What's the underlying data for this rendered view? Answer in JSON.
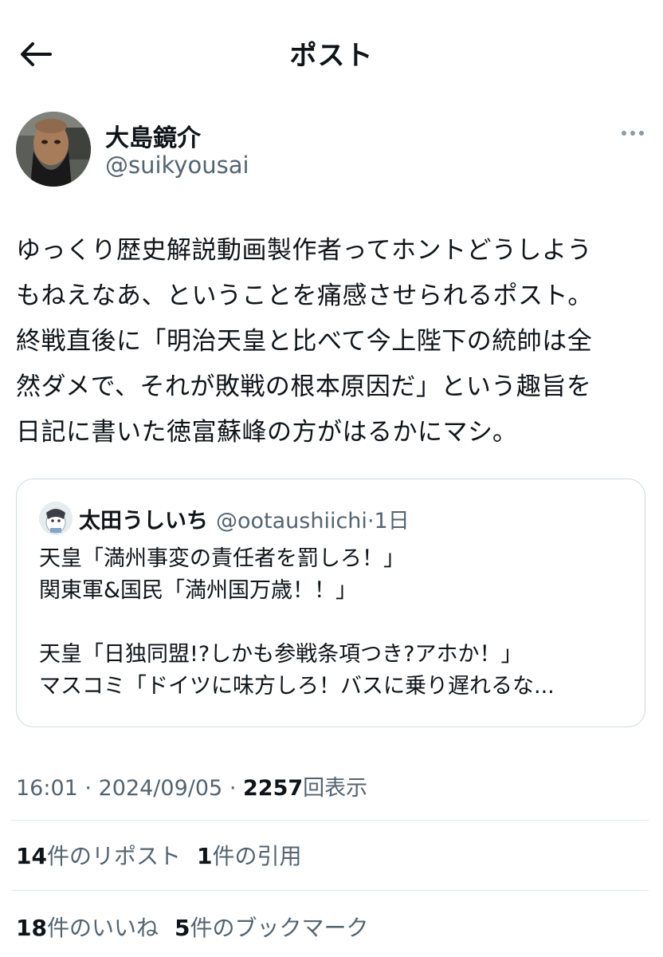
{
  "header": {
    "title": "ポスト",
    "back_icon": "arrow-left-icon"
  },
  "author": {
    "name": "大島鏡介",
    "handle": "@suikyousai",
    "more_icon": "more-horizontal-icon"
  },
  "post": {
    "text": "ゆっくり歴史解説動画製作者ってホントどうしよう\nもねえなあ、ということを痛感させられるポスト。\n終戦直後に「明治天皇と比べて今上陛下の統帥は全\n然ダメで、それが敗戦の根本原因だ」という趣旨を\n日記に書いた徳富蘇峰の方がはるかにマシ。"
  },
  "quote": {
    "name": "太田うしいち",
    "handle": "@ootaushiichi",
    "separator": "·",
    "time": "1日",
    "text": "天皇「満州事変の責任者を罰しろ！」\n関東軍&国民「満州国万歳！！」\n\n天皇「日独同盟!?しかも参戦条項つき?アホか！」\nマスコミ「ドイツに味方しろ！バスに乗り遅れるな..."
  },
  "meta": {
    "time": "16:01",
    "sep1": "·",
    "date": "2024/09/05",
    "sep2": "·",
    "views_count": "2257",
    "views_label": "回表示"
  },
  "stats": {
    "reposts_count": "14",
    "reposts_label": "件のリポスト",
    "quotes_count": "1",
    "quotes_label": "件の引用",
    "likes_count": "18",
    "likes_label": "件のいいね",
    "bookmarks_count": "5",
    "bookmarks_label": "件のブックマーク"
  },
  "colors": {
    "text": "#0f1419",
    "secondary": "#536471",
    "border": "#cfd9de",
    "divider": "#e1e8ed"
  }
}
